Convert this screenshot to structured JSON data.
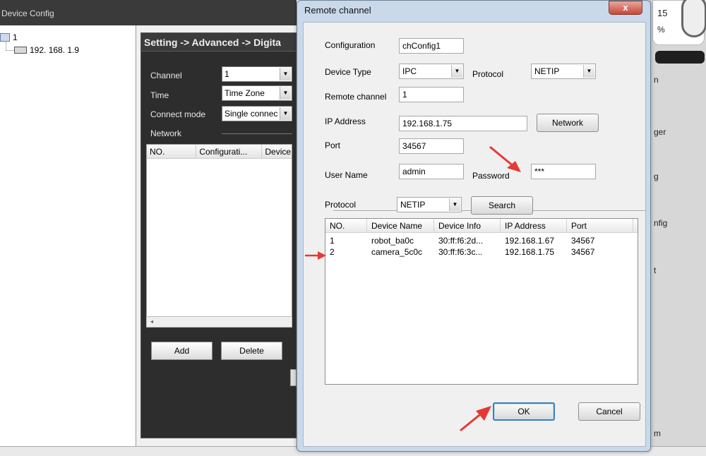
{
  "background_window": {
    "title": "Device Config",
    "tree": {
      "root_label": "1",
      "device_label": "192. 168. 1.9"
    },
    "panel_title": "Setting -> Advanced -> Digita",
    "fields": {
      "channel_label": "Channel",
      "channel_value": "1",
      "time_label": "Time",
      "time_value": "Time Zone",
      "connect_label": "Connect mode",
      "connect_value": "Single connec",
      "network_label": "Network"
    },
    "grid_columns": [
      "NO.",
      "Configurati...",
      "Device"
    ],
    "add_label": "Add",
    "delete_label": "Delete",
    "right_strip_texts": [
      "15",
      "%",
      "n",
      "ger",
      "g",
      "nfig",
      "t",
      "m"
    ]
  },
  "dialog": {
    "title": "Remote channel",
    "close_glyph": "x",
    "configuration_label": "Configuration",
    "configuration_value": "chConfig1",
    "device_type_label": "Device Type",
    "device_type_value": "IPC",
    "protocol_label": "Protocol",
    "protocol_value": "NETIP",
    "remote_channel_label": "Remote channel",
    "remote_channel_value": "1",
    "ip_label": "IP Address",
    "ip_value": "192.168.1.75",
    "network_button": "Network",
    "port_label": "Port",
    "port_value": "34567",
    "username_label": "User Name",
    "username_value": "admin",
    "password_label": "Password",
    "password_value": "***",
    "search_protocol_label": "Protocol",
    "search_protocol_value": "NETIP",
    "search_button": "Search",
    "table": {
      "columns": [
        "NO.",
        "Device Name",
        "Device Info",
        "IP Address",
        "Port"
      ],
      "rows": [
        [
          "1",
          "robot_ba0c",
          "30:ff:f6:2d...",
          "192.168.1.67",
          "34567"
        ],
        [
          "2",
          "camera_5c0c",
          "30:ff:f6:3c...",
          "192.168.1.75",
          "34567"
        ]
      ]
    },
    "ok_label": "OK",
    "cancel_label": "Cancel"
  },
  "annotation_color": "#e53935"
}
